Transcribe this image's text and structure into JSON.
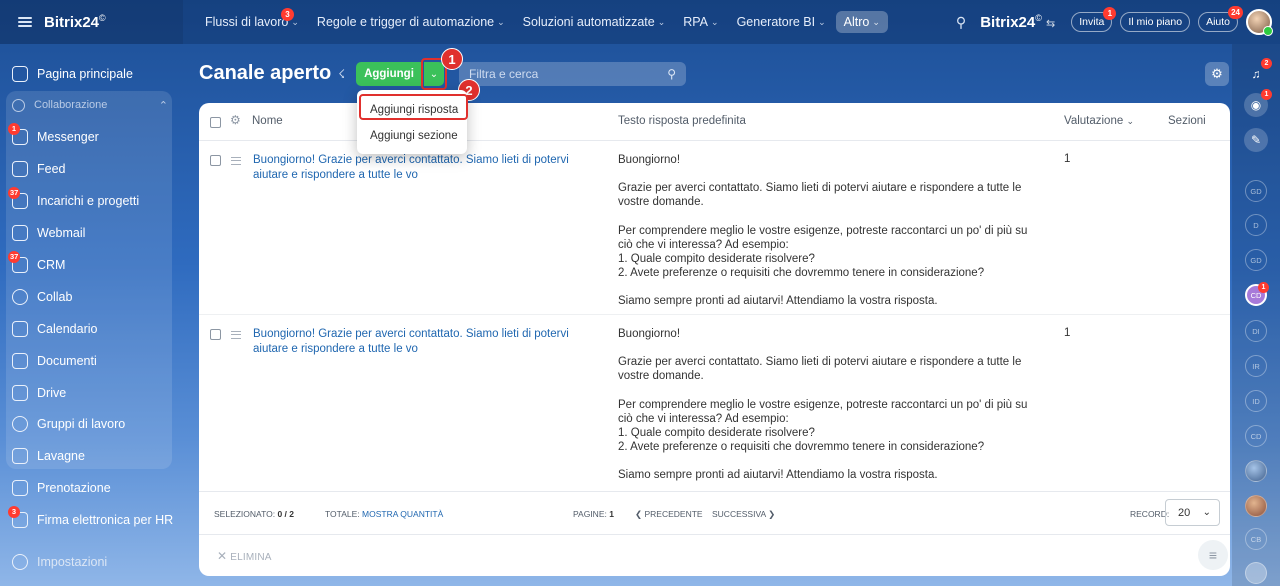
{
  "topbar": {
    "logo": "Bitrix24",
    "logo_mark": "©",
    "nav": [
      {
        "label": "Flussi di lavoro",
        "badge": "3"
      },
      {
        "label": "Regole e trigger di automazione"
      },
      {
        "label": "Soluzioni automatizzate"
      },
      {
        "label": "RPA"
      },
      {
        "label": "Generatore BI"
      },
      {
        "label": "Altro"
      }
    ],
    "brand_right": "Bitrix24",
    "invite_label": "Invita",
    "invite_badge": "1",
    "plan_label": "Il mio piano",
    "help_label": "Aiuto",
    "help_badge": "24"
  },
  "sidebar": {
    "items": [
      {
        "label": "Pagina principale"
      },
      {
        "label": "Collaborazione"
      },
      {
        "label": "Messenger",
        "badge": "1"
      },
      {
        "label": "Feed"
      },
      {
        "label": "Incarichi e progetti",
        "badge": "37"
      },
      {
        "label": "Webmail"
      },
      {
        "label": "CRM",
        "badge": "37"
      },
      {
        "label": "Collab"
      },
      {
        "label": "Calendario"
      },
      {
        "label": "Documenti"
      },
      {
        "label": "Drive"
      },
      {
        "label": "Gruppi di lavoro"
      },
      {
        "label": "Lavagne"
      },
      {
        "label": "Prenotazione"
      },
      {
        "label": "Firma elettronica per HR",
        "badge": "3"
      },
      {
        "label": "Impostazioni"
      }
    ]
  },
  "header": {
    "title": "Canale aperto",
    "add_label": "Aggiungi",
    "search_placeholder": "Filtra e cerca"
  },
  "steps": {
    "one": "1",
    "two": "2"
  },
  "dropdown": {
    "items": [
      "Aggiungi risposta",
      "Aggiungi sezione"
    ]
  },
  "table": {
    "columns": {
      "name": "Nome",
      "answer": "Testo risposta predefinita",
      "rating": "Valutazione",
      "sections": "Sezioni"
    },
    "rows": [
      {
        "name": "Buongiorno! Grazie per averci contattato. Siamo lieti di potervi aiutare e rispondere a tutte le vo",
        "answer": [
          "Buongiorno!",
          "Grazie per averci contattato. Siamo lieti di potervi aiutare e rispondere a tutte le vostre domande.",
          "Per comprendere meglio le vostre esigenze, potreste raccontarci un po' di più su ciò che vi interessa? Ad esempio:\n1. Quale compito desiderate risolvere?\n2. Avete preferenze o requisiti che dovremmo tenere in considerazione?",
          "Siamo sempre pronti ad aiutarvi! Attendiamo la vostra risposta."
        ],
        "rating": "1"
      },
      {
        "name": "Buongiorno! Grazie per averci contattato. Siamo lieti di potervi aiutare e rispondere a tutte le vo",
        "answer": [
          "Buongiorno!",
          "Grazie per averci contattato. Siamo lieti di potervi aiutare e rispondere a tutte le vostre domande.",
          "Per comprendere meglio le vostre esigenze, potreste raccontarci un po' di più su ciò che vi interessa? Ad esempio:\n1. Quale compito desiderate risolvere?\n2. Avete preferenze o requisiti che dovremmo tenere in considerazione?",
          "Siamo sempre pronti ad aiutarvi! Attendiamo la vostra risposta."
        ],
        "rating": "1"
      }
    ]
  },
  "footer": {
    "selected_label": "Selezionato:",
    "selected_value": "0 / 2",
    "total_label": "Totale:",
    "total_link": "Mostra quantità",
    "pages_label": "Pagine:",
    "pages_value": "1",
    "prev_label": "Precedente",
    "next_label": "Successiva",
    "records_label": "Record:",
    "records_value": "20",
    "delete_label": "Elimina"
  },
  "rail": {
    "notifications_badge": "2",
    "copilot_badge": "1",
    "avatars": [
      "GD",
      "D",
      "GD",
      "CD",
      "DI",
      "IR",
      "ID",
      "CD",
      "CB"
    ],
    "active_avatar_badge": "1"
  },
  "colors": {
    "accent_green": "#3bc15a",
    "highlight_red": "#e0302d",
    "link_blue": "#2067b0"
  }
}
